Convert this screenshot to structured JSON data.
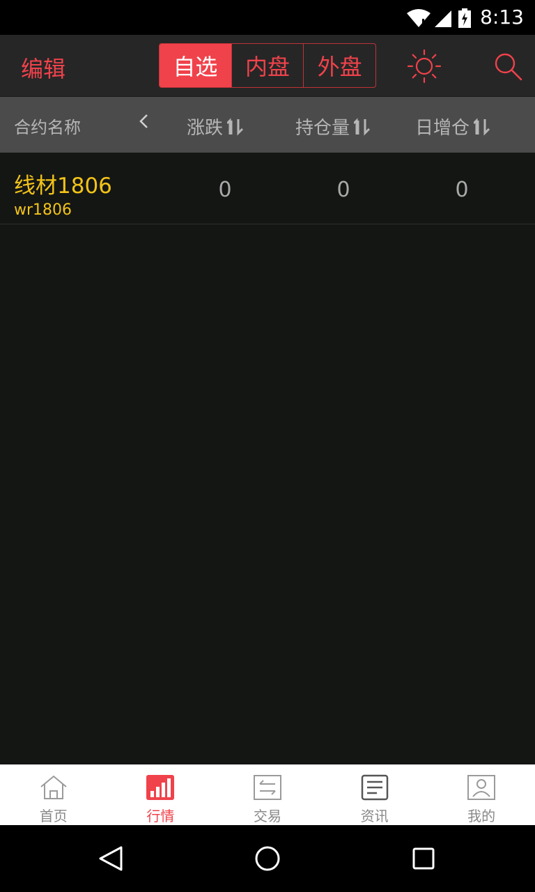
{
  "status_bar": {
    "time": "8:13"
  },
  "app_bar": {
    "edit_label": "编辑",
    "segments": [
      {
        "label": "自选",
        "active": true
      },
      {
        "label": "内盘",
        "active": false
      },
      {
        "label": "外盘",
        "active": false
      }
    ]
  },
  "columns": {
    "name": "合约名称",
    "change": "涨跌",
    "open_interest": "持仓量",
    "daily_increase": "日增仓"
  },
  "rows": [
    {
      "name": "线材1806",
      "code": "wr1806",
      "change": "0",
      "open_interest": "0",
      "daily_increase": "0"
    }
  ],
  "tabs": [
    {
      "label": "首页",
      "icon": "home-icon",
      "active": false
    },
    {
      "label": "行情",
      "icon": "bar-chart-icon",
      "active": true
    },
    {
      "label": "交易",
      "icon": "exchange-icon",
      "active": false
    },
    {
      "label": "资讯",
      "icon": "news-icon",
      "active": false
    },
    {
      "label": "我的",
      "icon": "profile-icon",
      "active": false
    }
  ],
  "colors": {
    "accent": "#f0424b",
    "highlight": "#f2c318",
    "background": "#141614"
  }
}
